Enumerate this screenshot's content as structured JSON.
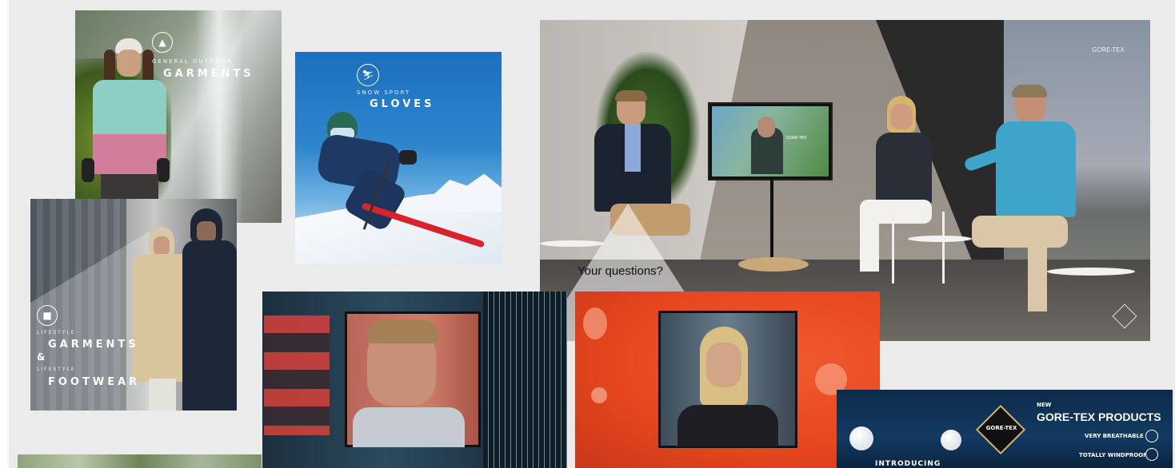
{
  "tiles": {
    "outdoor": {
      "category": "GENERAL OUTDOOR",
      "title": "GARMENTS"
    },
    "snow": {
      "category": "SNOW SPORT",
      "title": "GLOVES"
    },
    "lifestyle": {
      "category1": "LIFESTYLE",
      "title1": "GARMENTS",
      "amp": "&",
      "category2": "LIFESTYLE",
      "title2": "FOOTWEAR"
    },
    "panel": {
      "question": "Your questions?",
      "brand": "GORE-TEX",
      "tv_brand": "GORE-TEX"
    },
    "products": {
      "new": "NEW",
      "title": "GORE-TEX PRODUCTS",
      "feature1": "VERY BREATHABLE",
      "feature2": "TOTALLY WINDPROOF",
      "intro": "INTRODUCING",
      "badge": "GORE-TEX"
    }
  },
  "colors": {
    "background": "#ebebeb",
    "accent_orange": "#e8471e",
    "sky_blue": "#2f86cc"
  }
}
